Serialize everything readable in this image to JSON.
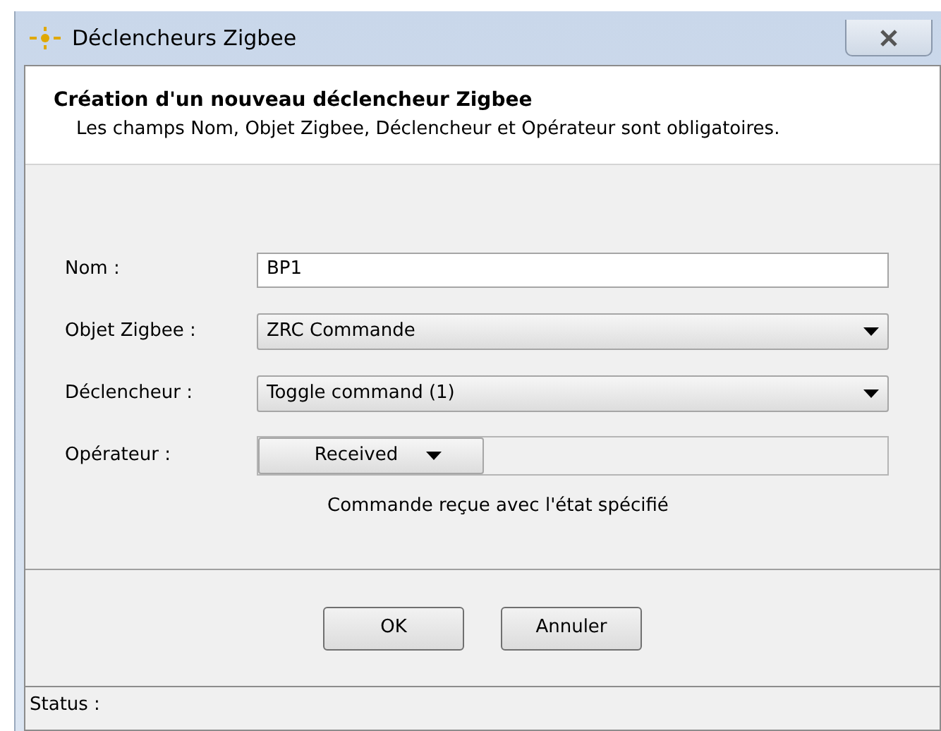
{
  "window": {
    "title": "Déclencheurs Zigbee"
  },
  "header": {
    "title": "Création d'un nouveau déclencheur Zigbee",
    "subtitle": "Les champs Nom, Objet Zigbee, Déclencheur et Opérateur sont obligatoires."
  },
  "fields": [
    {
      "kind": "text",
      "label": "Nom :",
      "value": "BP1"
    },
    {
      "kind": "select",
      "label": "Objet Zigbee :",
      "value": "ZRC Commande"
    },
    {
      "kind": "select",
      "label": "Déclencheur :",
      "value": "Toggle command (1)"
    },
    {
      "kind": "operator",
      "label": "Opérateur :",
      "value": "Received",
      "hint": "Commande reçue avec l'état spécifié"
    }
  ],
  "buttons": [
    "OK",
    "Annuler"
  ],
  "status_bar": "Status :"
}
